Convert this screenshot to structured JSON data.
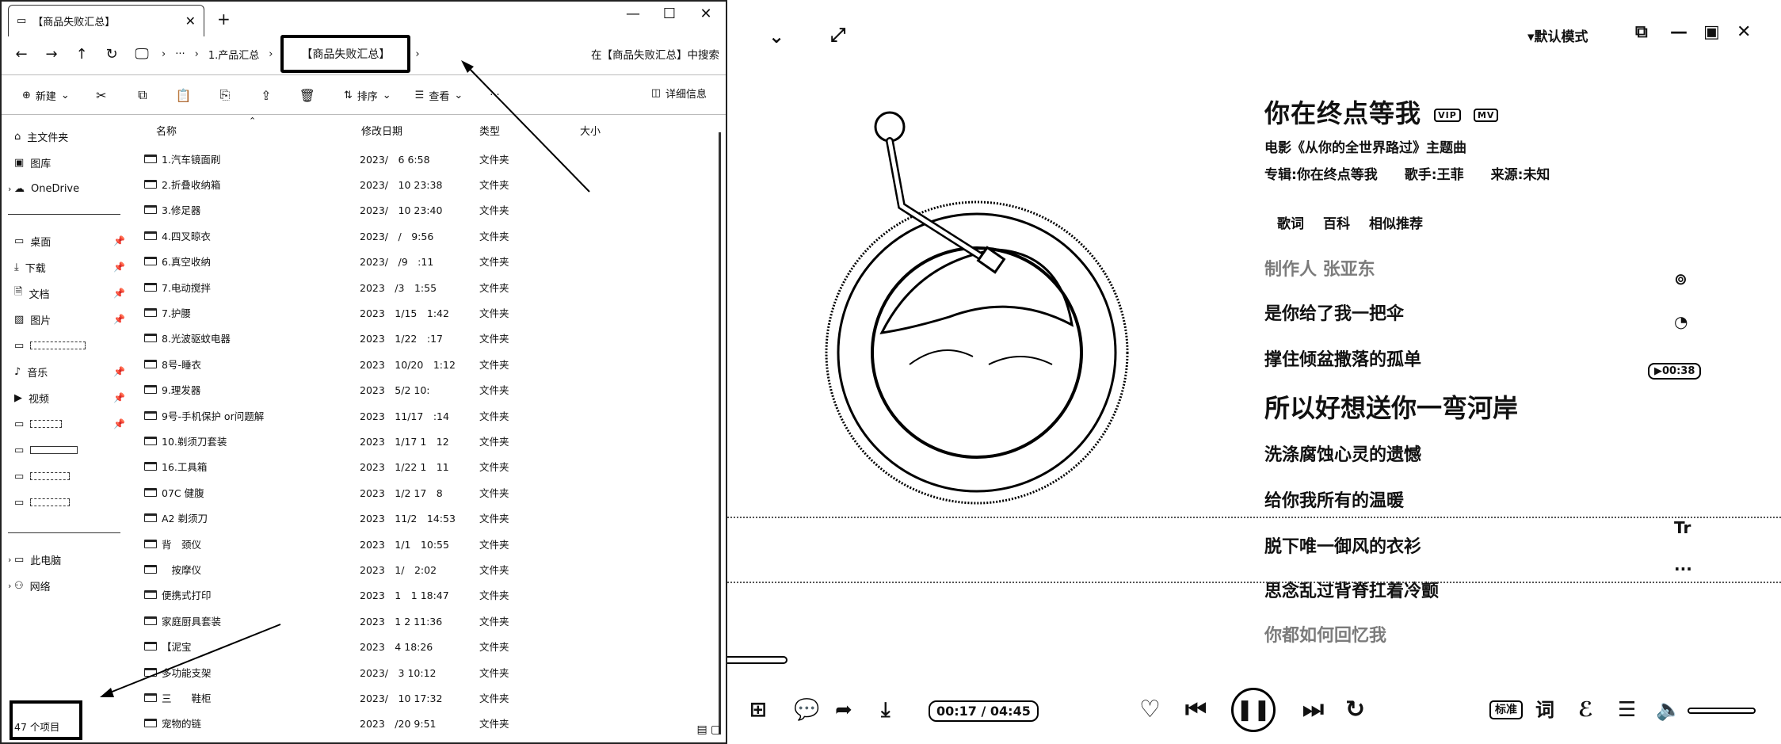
{
  "explorer": {
    "tab_title": "【商品失败汇总】",
    "new_tab": "+",
    "window_controls": {
      "minimize": "—",
      "maximize": "☐",
      "close": "✕"
    },
    "breadcrumb": {
      "ellipsis": "···",
      "parent": "1.产品汇总",
      "current": "【商品失败汇总】"
    },
    "search_label": "在【商品失败汇总】中搜索",
    "commands": {
      "new": "新建",
      "sort": "排序",
      "view": "查看",
      "more": "···",
      "details": "详细信息"
    },
    "sidebar": {
      "home": "主文件夹",
      "gallery": "图库",
      "onedrive": "OneDrive",
      "desktop": "桌面",
      "downloads": "下载",
      "documents": "文档",
      "pictures": "图片",
      "music": "音乐",
      "videos": "视频",
      "this_pc": "此电脑",
      "network": "网络"
    },
    "columns": {
      "name": "名称",
      "date": "修改日期",
      "type": "类型",
      "size": "大小"
    },
    "files": [
      {
        "name": "1.汽车镜面刷",
        "date": "2023/　6 6:58",
        "type": "文件夹"
      },
      {
        "name": "2.折叠收纳箱",
        "date": "2023/　10 23:38",
        "type": "文件夹"
      },
      {
        "name": "3.修足器",
        "date": "2023/　10 23:40",
        "type": "文件夹"
      },
      {
        "name": "4.四叉晾衣",
        "date": "2023/　/　9:56",
        "type": "文件夹"
      },
      {
        "name": "6.真空收纳",
        "date": "2023/　/9　:11",
        "type": "文件夹"
      },
      {
        "name": "7.电动搅拌",
        "date": "2023　/3　1:55",
        "type": "文件夹"
      },
      {
        "name": "7.护腰",
        "date": "2023　1/15　1:42",
        "type": "文件夹"
      },
      {
        "name": "8.光波驱蚊电器",
        "date": "2023　1/22　:17",
        "type": "文件夹"
      },
      {
        "name": "8号-睡衣",
        "date": "2023　10/20　1:12",
        "type": "文件夹"
      },
      {
        "name": "9.理发器",
        "date": "2023　5/2 10:　",
        "type": "文件夹"
      },
      {
        "name": "9号-手机保护 or问题解",
        "date": "2023　11/17　:14",
        "type": "文件夹"
      },
      {
        "name": "10.剃须刀套装",
        "date": "2023　1/17 1　12",
        "type": "文件夹"
      },
      {
        "name": "16.工具箱",
        "date": "2023　1/22 1　11",
        "type": "文件夹"
      },
      {
        "name": "07C 健腹",
        "date": "2023　1/2 17　8",
        "type": "文件夹"
      },
      {
        "name": "A2 剃须刀",
        "date": "2023　11/2　14:53",
        "type": "文件夹"
      },
      {
        "name": "背　颈仪",
        "date": "2023　1/1　10:55",
        "type": "文件夹"
      },
      {
        "name": "　按摩仪",
        "date": "2023　1/　2:02",
        "type": "文件夹"
      },
      {
        "name": "便携式打印",
        "date": "2023　1　1 18:47",
        "type": "文件夹"
      },
      {
        "name": "家庭厨具套装",
        "date": "2023　1 2 11:36",
        "type": "文件夹"
      },
      {
        "name": "【泥宝",
        "date": "2023　4 18:26",
        "type": "文件夹"
      },
      {
        "name": "多功能支架",
        "date": "2023/　3 10:12",
        "type": "文件夹"
      },
      {
        "name": "三　　鞋柜",
        "date": "2023/　10 17:32",
        "type": "文件夹"
      },
      {
        "name": "宠物的链",
        "date": "2023　/20 9:51",
        "type": "文件夹"
      }
    ],
    "status_count": "47 个项目"
  },
  "player": {
    "mode": "默认模式",
    "title": "你在终点等我",
    "badges": [
      "VIP",
      "MV"
    ],
    "subtitle": "电影《从你的全世界路过》主题曲",
    "album_label": "专辑:",
    "album": "你在终点等我",
    "singer_label": "歌手:",
    "singer": "王菲",
    "source_label": "来源:",
    "source": "未知",
    "tabs": [
      "歌词",
      "百科",
      "相似推荐"
    ],
    "lyrics": [
      {
        "text": "制作人 张亚东",
        "state": "faded"
      },
      {
        "text": "是你给了我一把伞",
        "state": "normal"
      },
      {
        "text": "撑住倾盆撒落的孤单",
        "state": "normal"
      },
      {
        "text": "所以好想送你一弯河岸",
        "state": "current"
      },
      {
        "text": "洗涤腐蚀心灵的遗憾",
        "state": "normal"
      },
      {
        "text": "给你我所有的温暖",
        "state": "normal"
      },
      {
        "text": "脱下唯一御风的衣衫",
        "state": "normal"
      },
      {
        "text": "思念乱过背脊扛着冷颤",
        "state": "normal"
      },
      {
        "text": "你都如何回忆我",
        "state": "faded"
      }
    ],
    "lyric_time_badge": "00:38",
    "elapsed": "00:17",
    "total": "04:45",
    "time_readout": "00:17 / 04:45",
    "quality_label": "标准",
    "lyrics_button": "词",
    "volume": 1.0,
    "icons": {
      "collapse": "chevron-down-icon",
      "fullscreen": "expand-icon",
      "like": "heart-icon",
      "prev": "prev-icon",
      "play": "pause-icon",
      "next": "next-icon",
      "loop": "loop-icon"
    }
  }
}
